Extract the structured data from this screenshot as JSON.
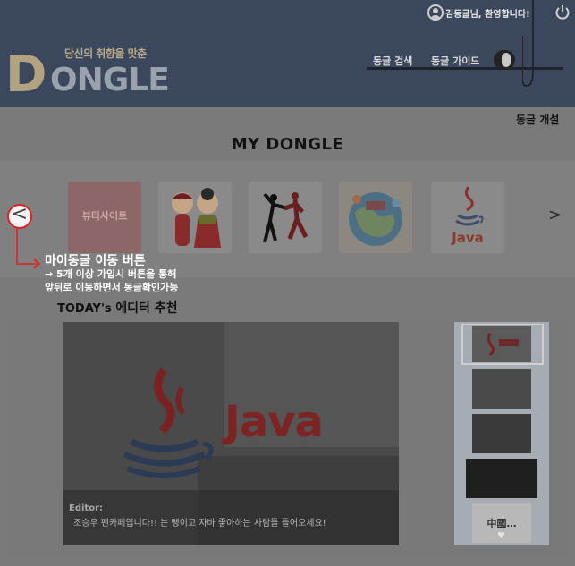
{
  "header": {
    "greeting": "김동글님, 환영합니다!",
    "logo_tagline": "당신의 취향을 맞춘",
    "logo_d": "D",
    "logo_rest": "ONGLE",
    "nav": [
      "동글 검색",
      "동글 가이드"
    ]
  },
  "main": {
    "open_club": "동글 개설",
    "title": "MY DONGLE"
  },
  "carousel": {
    "clubs": [
      {
        "icon": "beauty-site-logo",
        "text": "뷰티사이트"
      },
      {
        "icon": "korean-couple-illustration"
      },
      {
        "icon": "dancers-silhouette"
      },
      {
        "icon": "travel-globe-illustration"
      },
      {
        "icon": "java-logo",
        "text": "Java"
      }
    ],
    "prev": "<",
    "next": ">"
  },
  "annotation": {
    "title": "마이동글 이동 버튼",
    "line1": "→ 5개 이상 가입시 버튼을 통해",
    "line2": "앞뒤로 이동하면서 동글확인가능"
  },
  "today": {
    "label": "TODAY's",
    "emphasis": "에디터 추천"
  },
  "feature": {
    "main_image_text": "Java",
    "caption_label": "Editor:",
    "caption_text": "조승우 펜카페입니다!! 는 뻥이고 자바 좋아하는 사람들 들어오세요!",
    "thumb_logo_text": "中國…",
    "down_icon": "chevron-down-icon"
  }
}
